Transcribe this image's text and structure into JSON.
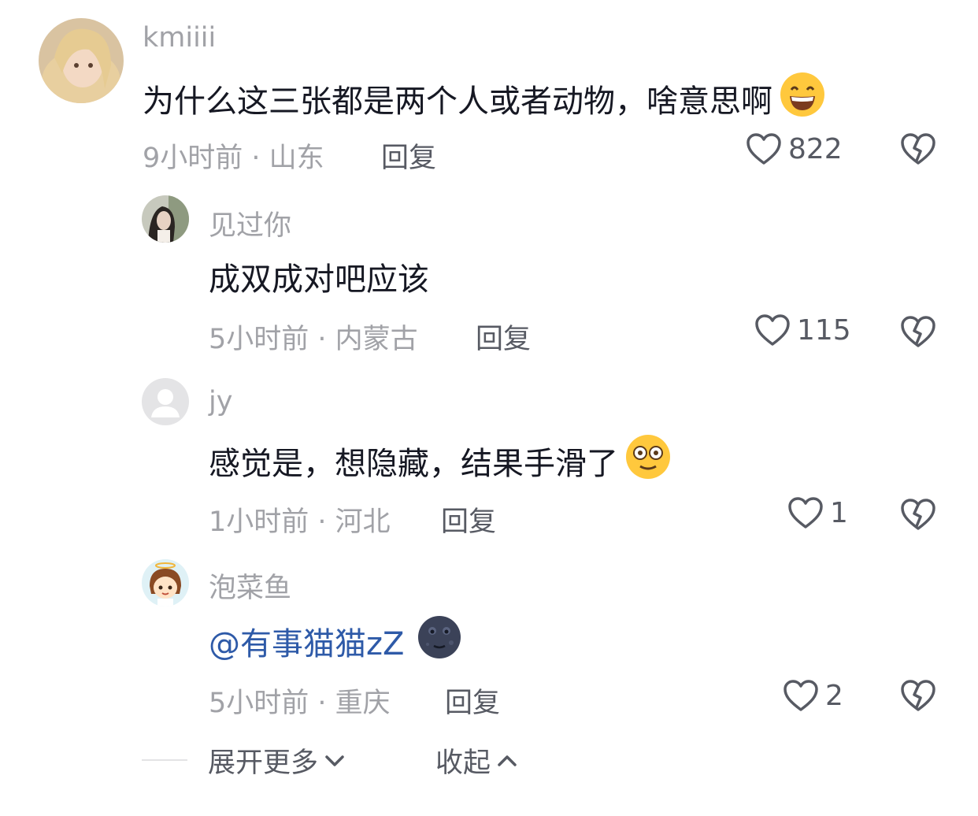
{
  "comments": [
    {
      "username": "kmiiii",
      "text": "为什么这三张都是两个人或者动物，啥意思啊",
      "emoji": "grinning-emoji",
      "time_location": "9小时前 · 山东",
      "reply_label": "回复",
      "likes": "822"
    },
    {
      "username": "见过你",
      "text": "成双成对吧应该",
      "time_location": "5小时前 · 内蒙古",
      "reply_label": "回复",
      "likes": "115"
    },
    {
      "username": "jy",
      "text": "感觉是，想隐藏，结果手滑了",
      "emoji": "dizzy-face-emoji",
      "time_location": "1小时前 · 河北",
      "reply_label": "回复",
      "likes": "1"
    },
    {
      "username": "泡菜鱼",
      "text": "@有事猫猫zZ",
      "emoji": "moon-face-emoji",
      "time_location": "5小时前 · 重庆",
      "reply_label": "回复",
      "likes": "2"
    }
  ],
  "footer": {
    "expand_label": "展开更多",
    "collapse_label": "收起"
  },
  "colors": {
    "muted": "#a1a2a7",
    "secondary": "#575a63",
    "mention": "#2e5aa8"
  }
}
